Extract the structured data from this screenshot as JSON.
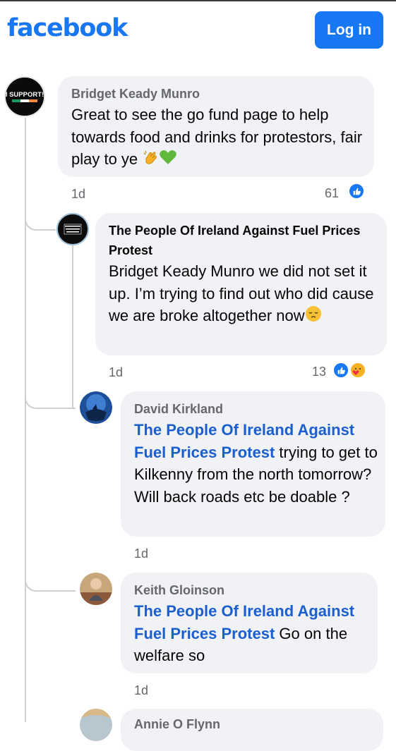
{
  "header": {
    "logo_text": "facebook",
    "login_label": "Log in"
  },
  "colors": {
    "brand": "#1877f2",
    "mention": "#1b5fcf",
    "bubble": "#f0f2f5",
    "meta": "#65676b"
  },
  "comments": [
    {
      "author": "Bridget Keady Munro",
      "avatar_text_1": "I SUPPORT!",
      "avatar_text_2": "IRISH FUEL PROTEST",
      "text": "Great to see the go fund page to help towards food and drinks for protestors, fair play to ye",
      "emojis": [
        "clapping-hands",
        "green-heart"
      ],
      "time": "1d",
      "reaction_count": "61",
      "reactions": [
        "like"
      ]
    },
    {
      "author": "The People Of Ireland Against Fuel Prices Protest",
      "avatar_text": "IRISH PEOPLE AGAINST FUEL PRICES",
      "text": "Bridget Keady Munro we did not set it up.  I’m trying to find out who did cause we are broke altogether now",
      "emojis": [
        "pensive-face"
      ],
      "time": "1d",
      "reaction_count": "13",
      "reactions": [
        "like",
        "care"
      ]
    },
    {
      "author": "David Kirkland",
      "mention": "The People Of Ireland Against Fuel Prices Protest",
      "text": " trying to get to Kilkenny from the north tomorrow? Will back roads etc be doable ?",
      "time": "1d"
    },
    {
      "author": "Keith Gloinson",
      "mention": "The People Of Ireland Against Fuel Prices Protest",
      "text": " Go on the welfare so",
      "time": "1d"
    },
    {
      "author": "Annie O Flynn"
    }
  ]
}
